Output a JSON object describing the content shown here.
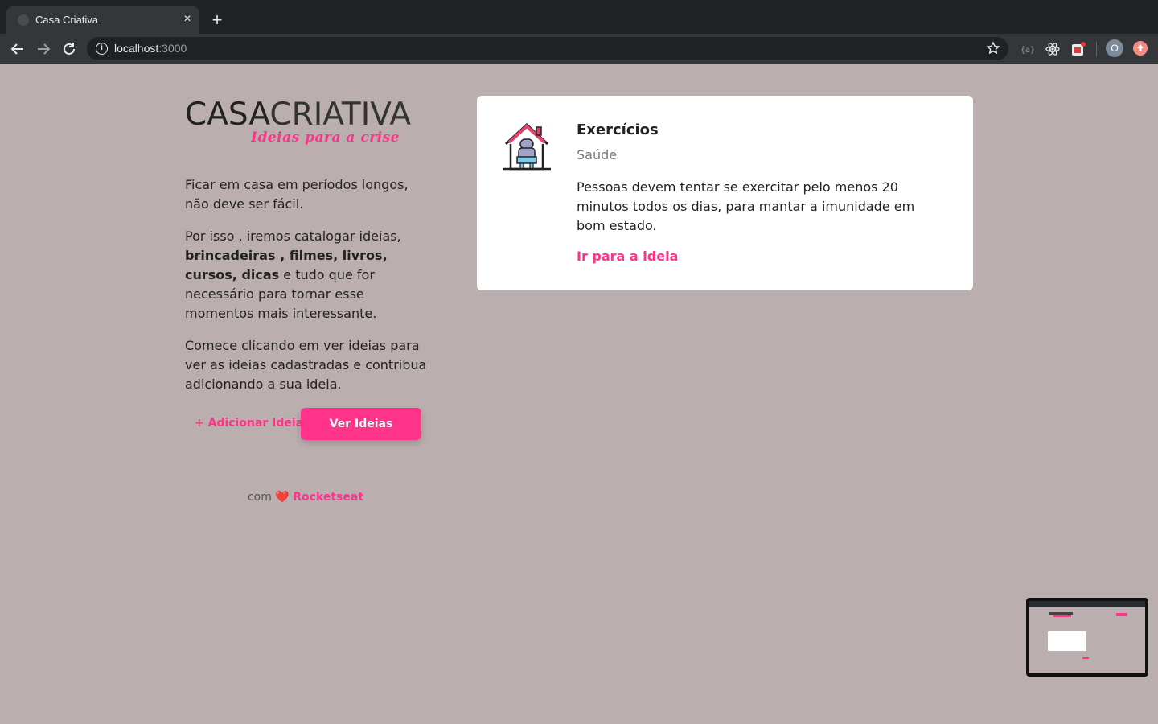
{
  "browser": {
    "tab_title": "Casa Criativa",
    "tab_close": "×",
    "new_tab": "+",
    "url_host": "localhost",
    "url_port": ":3000",
    "profile_initial": "O"
  },
  "logo": {
    "word1": "CASA",
    "word2": "CRIATIVA",
    "tagline": "Ideias para a crise"
  },
  "intro": {
    "p1": "Ficar em casa em períodos longos, não deve ser fácil.",
    "p2_start": "Por isso , iremos catalogar ideias, ",
    "p2_bold": "brincadeiras , filmes, livros, cursos, dicas",
    "p2_end": " e tudo que for necessário para tornar esse momentos mais interessante.",
    "p3": "Comece clicando em ver ideias para ver as ideias cadastradas e contribua adicionando a sua ideia."
  },
  "actions": {
    "add_label": "+ Adicionar Ideia",
    "see_label": "Ver Ideias"
  },
  "footer": {
    "prefix": "com",
    "heart": "❤️",
    "brand": "Rocketseat"
  },
  "idea": {
    "title": "Exercícios",
    "category": "Saúde",
    "description": "Pessoas devem tentar se exercitar pelo menos 20 minutos todos os dias, para mantar a imunidade em bom estado.",
    "link": "Ir para a ideia"
  },
  "colors": {
    "accent": "#FF338A",
    "background": "#BBAEAE"
  }
}
